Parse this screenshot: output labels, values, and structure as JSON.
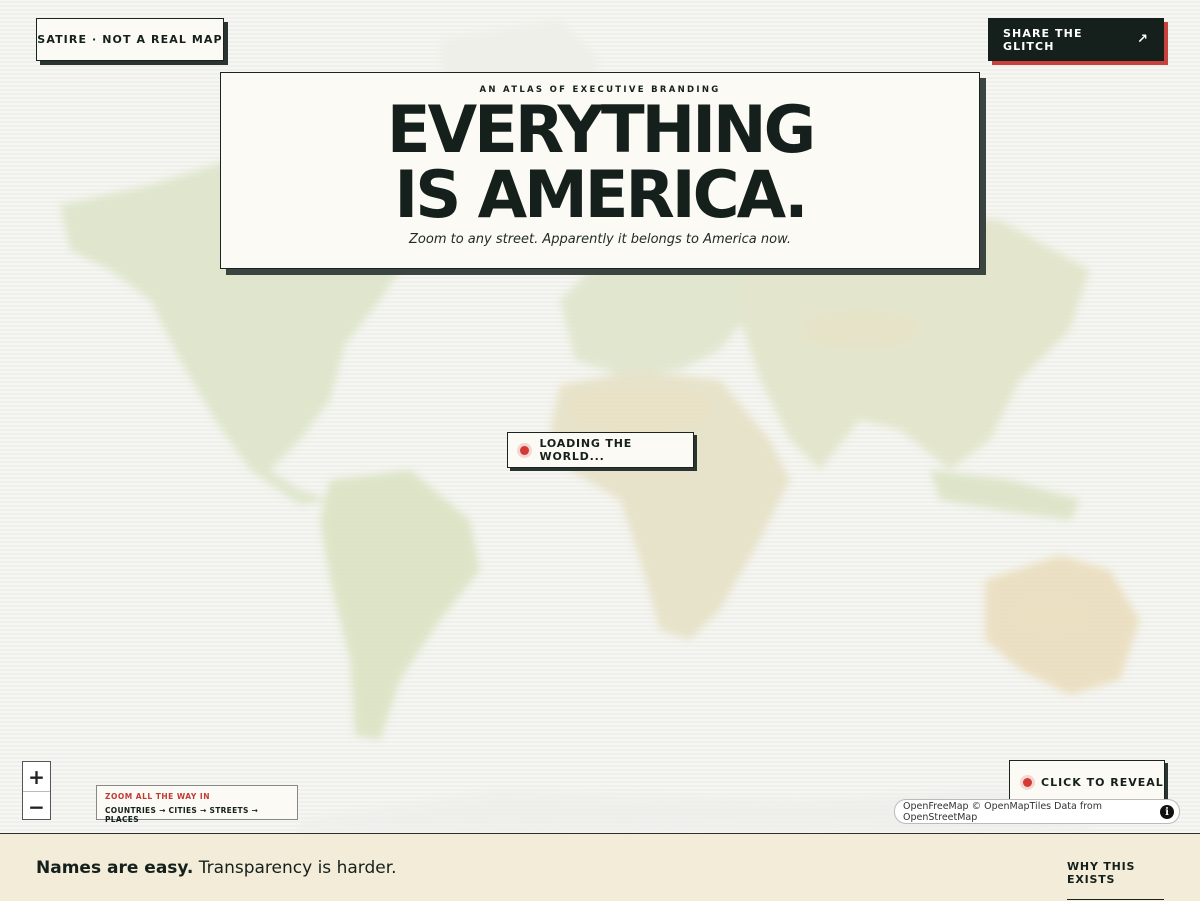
{
  "badge": {
    "label": "SATIRE · NOT A REAL MAP"
  },
  "share": {
    "label": "SHARE THE GLITCH",
    "icon": "arrow-up-right-icon",
    "glyph": "↗"
  },
  "hero": {
    "kicker": "AN ATLAS OF EXECUTIVE BRANDING",
    "headline_line1": "EVERYTHING",
    "headline_line2": "IS AMERICA.",
    "subhead": "Zoom to any street. Apparently it belongs to America now."
  },
  "status": {
    "loading_label": "LOADING THE WORLD..."
  },
  "zoom": {
    "in": "+",
    "out": "−"
  },
  "hint": {
    "title": "ZOOM ALL THE WAY IN",
    "steps": "COUNTRIES → CITIES → STREETS → PLACES"
  },
  "reveal": {
    "label": "CLICK TO REVEAL"
  },
  "attribution": {
    "text": "OpenFreeMap © OpenMapTiles Data from OpenStreetMap",
    "info": "i"
  },
  "footer": {
    "tagline_bold": "Names are easy.",
    "tagline_rest": " Transparency is harder.",
    "link": "WHY THIS EXISTS"
  },
  "colors": {
    "accent": "#d33a35",
    "ink": "#15201d",
    "paper": "#fbfaf4",
    "footer_bg": "#f2ecd9",
    "land": "#c9d8b0",
    "desert": "#e6d6b4"
  }
}
